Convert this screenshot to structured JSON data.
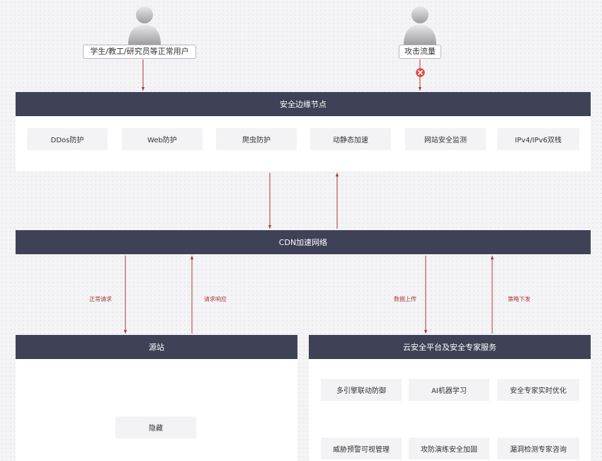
{
  "users": {
    "normal": "学生/教工/研究员等正常用户",
    "attack": "攻击流量"
  },
  "edge": {
    "title": "安全边缘节点",
    "features": [
      "DDos防护",
      "Web防护",
      "爬虫防护",
      "动静态加速",
      "网站安全监测",
      "IPv4/IPv6双栈"
    ]
  },
  "cdn": {
    "title": "CDN加速网络"
  },
  "flows": {
    "normal_request": "正常请求",
    "response": "请求响应",
    "upload": "数据上传",
    "policy": "策略下发"
  },
  "origin": {
    "title": "源站",
    "item": "隐藏"
  },
  "cloud": {
    "title": "云安全平台及安全专家服务",
    "features": [
      "多引擎联动防御",
      "AI机器学习",
      "安全专家实时优化",
      "威胁预警可视管理",
      "攻防演练安全加固",
      "漏洞检测专家咨询"
    ]
  },
  "colors": {
    "bar": "#3f4156",
    "arrow": "#a83b3b",
    "block": "#e04b4b"
  }
}
